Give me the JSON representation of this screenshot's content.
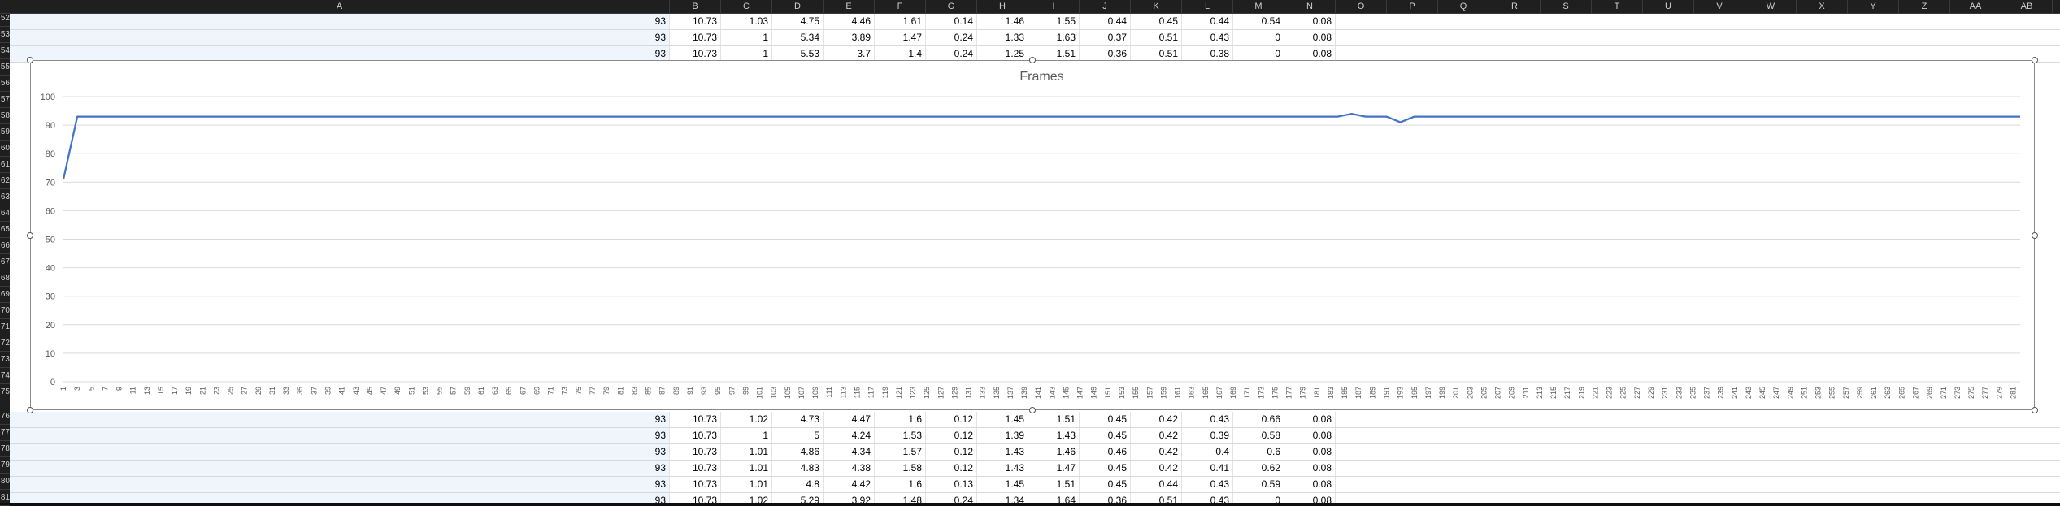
{
  "columns": [
    "A",
    "B",
    "C",
    "D",
    "E",
    "F",
    "G",
    "H",
    "I",
    "J",
    "K",
    "L",
    "M",
    "N",
    "O",
    "P",
    "Q",
    "R",
    "S",
    "T",
    "U",
    "V",
    "W",
    "X",
    "Y",
    "Z",
    "AA",
    "AB"
  ],
  "row_numbers_top": [
    "52",
    "53",
    "54",
    "55",
    "56",
    "57",
    "58",
    "59",
    "60",
    "61",
    "62",
    "63",
    "64",
    "65",
    "66",
    "67",
    "68",
    "69",
    "70",
    "71",
    "72",
    "73",
    "74",
    "75"
  ],
  "row_numbers_bottom": [
    "76",
    "77",
    "78",
    "79",
    "80",
    "81"
  ],
  "rows_top": [
    [
      "93",
      "10.73",
      "1.03",
      "4.75",
      "4.46",
      "1.61",
      "0.14",
      "1.46",
      "1.55",
      "0.44",
      "0.45",
      "0.44",
      "0.54",
      "0.08"
    ],
    [
      "93",
      "10.73",
      "1",
      "5.34",
      "3.89",
      "1.47",
      "0.24",
      "1.33",
      "1.63",
      "0.37",
      "0.51",
      "0.43",
      "0",
      "0.08"
    ],
    [
      "93",
      "10.73",
      "1",
      "5.53",
      "3.7",
      "1.4",
      "0.24",
      "1.25",
      "1.51",
      "0.36",
      "0.51",
      "0.38",
      "0",
      "0.08"
    ]
  ],
  "rows_bottom": [
    [
      "93",
      "10.73",
      "1.02",
      "4.73",
      "4.47",
      "1.6",
      "0.12",
      "1.45",
      "1.51",
      "0.45",
      "0.42",
      "0.43",
      "0.66",
      "0.08"
    ],
    [
      "93",
      "10.73",
      "1",
      "5",
      "4.24",
      "1.53",
      "0.12",
      "1.39",
      "1.43",
      "0.45",
      "0.42",
      "0.39",
      "0.58",
      "0.08"
    ],
    [
      "93",
      "10.73",
      "1.01",
      "4.86",
      "4.34",
      "1.57",
      "0.12",
      "1.43",
      "1.46",
      "0.46",
      "0.42",
      "0.4",
      "0.6",
      "0.08"
    ],
    [
      "93",
      "10.73",
      "1.01",
      "4.83",
      "4.38",
      "1.58",
      "0.12",
      "1.43",
      "1.47",
      "0.45",
      "0.42",
      "0.41",
      "0.62",
      "0.08"
    ],
    [
      "93",
      "10.73",
      "1.01",
      "4.8",
      "4.42",
      "1.6",
      "0.13",
      "1.45",
      "1.51",
      "0.45",
      "0.44",
      "0.43",
      "0.59",
      "0.08"
    ],
    [
      "93",
      "10.73",
      "1.02",
      "5.29",
      "3.92",
      "1.48",
      "0.24",
      "1.34",
      "1.64",
      "0.36",
      "0.51",
      "0.43",
      "0",
      "0.08"
    ]
  ],
  "colors": {
    "series": "#4472c4",
    "grid": "#d9d9d9",
    "axis_text": "#595959"
  },
  "chart_data": {
    "type": "line",
    "title": "Frames",
    "xlabel": "",
    "ylabel": "",
    "ylim": [
      0,
      100
    ],
    "yticks": [
      0,
      10,
      20,
      30,
      40,
      50,
      60,
      70,
      80,
      90,
      100
    ],
    "x_start": 1,
    "x_end": 282,
    "x_tick_step": 2,
    "grid": true,
    "legend": "none",
    "series": [
      {
        "baseline": 93,
        "points": [
          [
            1,
            71
          ],
          [
            3,
            93
          ],
          [
            184,
            93
          ],
          [
            186,
            94
          ],
          [
            188,
            93
          ],
          [
            191,
            93
          ],
          [
            193,
            91
          ],
          [
            195,
            93
          ],
          [
            282,
            93
          ]
        ]
      }
    ]
  }
}
